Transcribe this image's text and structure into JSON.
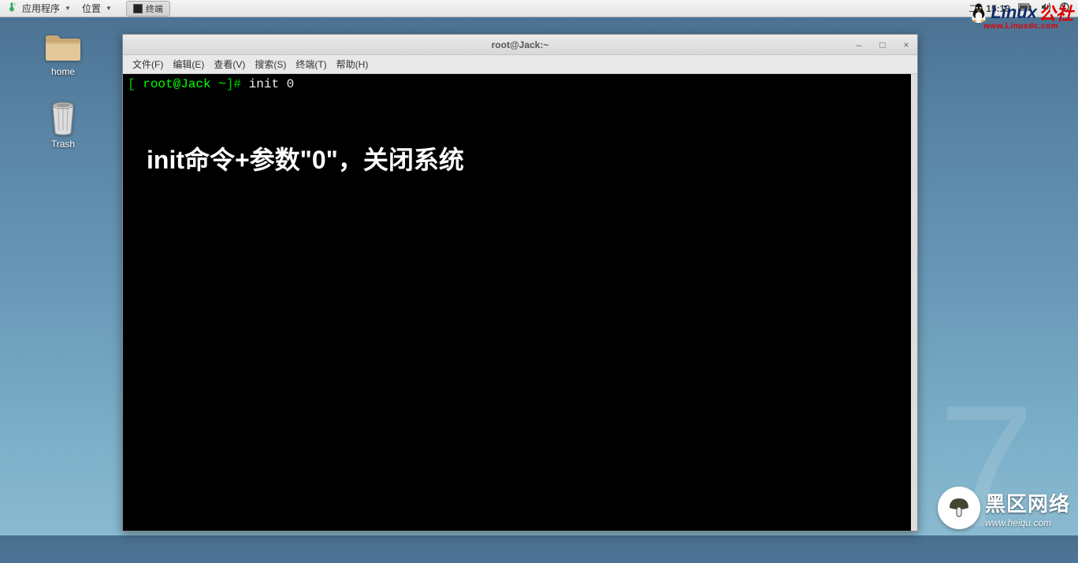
{
  "top_panel": {
    "applications": "应用程序",
    "places": "位置",
    "task_terminal": "终端",
    "day": "二",
    "time": "15:19"
  },
  "desktop": {
    "home_label": "home",
    "trash_label": "Trash"
  },
  "terminal": {
    "title": "root@Jack:~",
    "menu": {
      "file": "文件(F)",
      "edit": "编辑(E)",
      "view": "查看(V)",
      "search": "搜索(S)",
      "terminal": "终端(T)",
      "help": "帮助(H)"
    },
    "prompt_open": "[",
    "prompt_user": " root@Jack ~",
    "prompt_close": "]# ",
    "command": "init 0",
    "annotation": "init命令+参数\"0\"，关闭系统"
  },
  "watermarks": {
    "big": "7",
    "linux_text1": "Linux",
    "linux_text2": "公社",
    "linux_url": "www.Linuxdc.com",
    "heiqu_main": "黑区网络",
    "heiqu_sub": "www.heiqu.com"
  }
}
